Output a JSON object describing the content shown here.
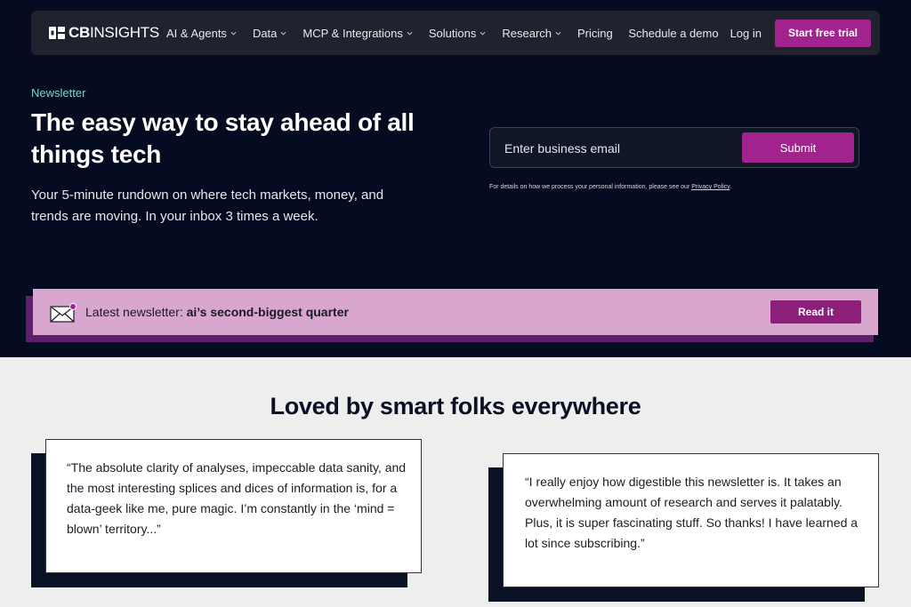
{
  "nav": {
    "logo_cb": "CB",
    "logo_insights": "INSIGHTS",
    "items": [
      {
        "label": "AI & Agents",
        "dropdown": true
      },
      {
        "label": "Data",
        "dropdown": true
      },
      {
        "label": "MCP & Integrations",
        "dropdown": true
      },
      {
        "label": "Solutions",
        "dropdown": true
      },
      {
        "label": "Research",
        "dropdown": true
      },
      {
        "label": "Pricing",
        "dropdown": false
      }
    ],
    "schedule_demo": "Schedule a demo",
    "log_in": "Log in",
    "start_trial": "Start free trial"
  },
  "hero": {
    "eyebrow": "Newsletter",
    "headline": "The easy way to stay ahead of all things tech",
    "subhead": "Your 5-minute rundown on where tech markets, money, and trends are moving. In your inbox 3 times a week.",
    "email_placeholder": "Enter business email",
    "submit_label": "Submit",
    "privacy_text": "For details on how we process your personal information, please see our ",
    "privacy_link": "Privacy Policy",
    "privacy_end": "."
  },
  "banner": {
    "prefix": "Latest newsletter: ",
    "title": "ai’s second-biggest quarter",
    "button": "Read it"
  },
  "social": {
    "title": "Loved by smart folks everywhere",
    "testimonials": [
      {
        "quote": "“The absolute clarity of analyses, impeccable data sanity, and the most interesting splices and dices of information is, for a data-geek like me, pure magic. I’m constantly in the ‘mind = blown’ territory...”"
      },
      {
        "quote": "“I really enjoy how digestible this newsletter is. It takes an overwhelming amount of research and serves it palatably. Plus, it is super fascinating stuff. So thanks! I have learned a lot since subscribing.”"
      }
    ]
  },
  "colors": {
    "brand_purple": "#a3238e",
    "navy": "#050c22",
    "teal": "#7fd3c6",
    "banner_pink": "#d8a6cf"
  }
}
